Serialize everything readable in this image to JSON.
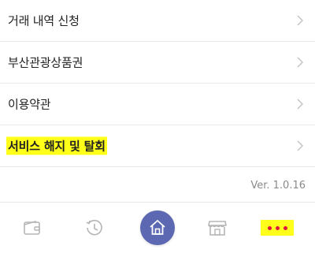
{
  "menu": {
    "items": [
      {
        "label": "거래 내역 신청",
        "highlighted": false
      },
      {
        "label": "부산관광상품권",
        "highlighted": false
      },
      {
        "label": "이용약관",
        "highlighted": false
      },
      {
        "label": "서비스 해지 및 탈회",
        "highlighted": true
      }
    ]
  },
  "version": "Ver. 1.0.16",
  "tabbar": {
    "tabs": [
      {
        "icon": "wallet-icon"
      },
      {
        "icon": "history-icon"
      },
      {
        "icon": "home-icon",
        "active": true
      },
      {
        "icon": "store-icon"
      },
      {
        "icon": "more-icon",
        "highlighted": true
      }
    ]
  },
  "colors": {
    "accent": "#5c68b2",
    "highlight": "#ffff1a",
    "more_dots": "#e0143c",
    "icon_gray": "#b5b5b5"
  }
}
